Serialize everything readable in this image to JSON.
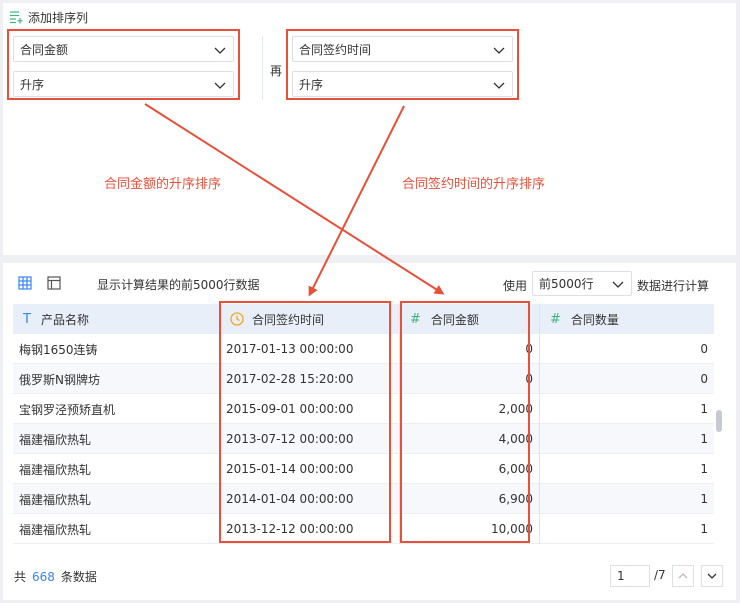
{
  "sort_config": {
    "add_sort_label": "添加排序列",
    "primary": {
      "field": "合同金额",
      "order": "升序"
    },
    "then_label": "再",
    "secondary": {
      "field": "合同签约时间",
      "order": "升序"
    }
  },
  "annotations": {
    "left": "合同金额的升序排序",
    "right": "合同签约时间的升序排序"
  },
  "toolbar": {
    "info_text": "显示计算结果的前5000行数据",
    "use_label": "使用",
    "row_limit_value": "前5000行",
    "compute_label": "数据进行计算"
  },
  "table": {
    "columns": [
      {
        "type_icon": "T",
        "label": "产品名称"
      },
      {
        "type_icon": "clock",
        "label": "合同签约时间"
      },
      {
        "type_icon": "#",
        "label": "合同金额"
      },
      {
        "type_icon": "#",
        "label": "合同数量"
      }
    ],
    "rows": [
      [
        "梅钢1650连铸",
        "2017-01-13 00:00:00",
        "0",
        "0"
      ],
      [
        "俄罗斯N钢牌坊",
        "2017-02-28 15:20:00",
        "0",
        "0"
      ],
      [
        "宝钢罗泾预矫直机",
        "2015-09-01 00:00:00",
        "2,000",
        "1"
      ],
      [
        "福建福欣热轧",
        "2013-07-12 00:00:00",
        "4,000",
        "1"
      ],
      [
        "福建福欣热轧",
        "2015-01-14 00:00:00",
        "6,000",
        "1"
      ],
      [
        "福建福欣热轧",
        "2014-01-04 00:00:00",
        "6,900",
        "1"
      ],
      [
        "福建福欣热轧",
        "2013-12-12 00:00:00",
        "10,000",
        "1"
      ]
    ]
  },
  "footer": {
    "total_prefix": "共",
    "total_count": "668",
    "total_suffix": "条数据",
    "page_current": "1",
    "page_total": "/7"
  },
  "colors": {
    "accent": "#3685f2",
    "annotation": "#e8503a",
    "header_bg": "#e9eff8",
    "clock": "#f5a623"
  }
}
